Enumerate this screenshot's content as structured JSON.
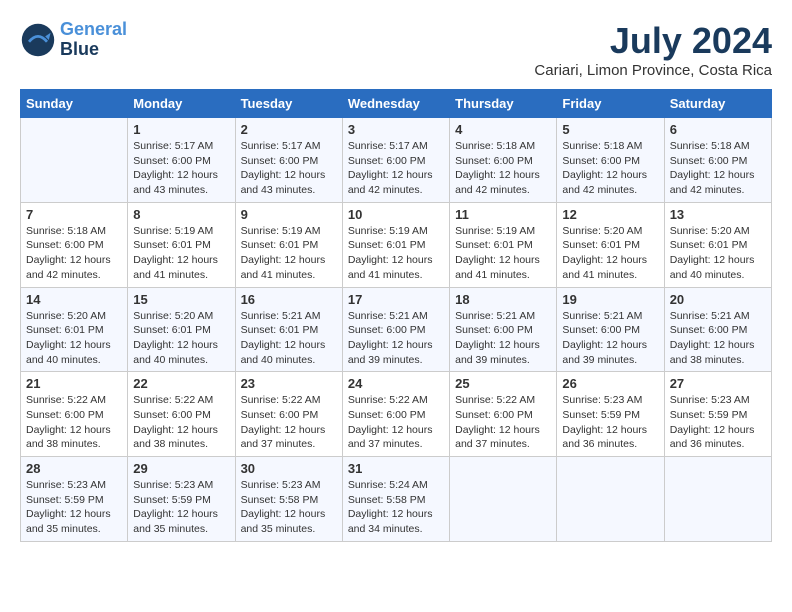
{
  "logo": {
    "line1": "General",
    "line2": "Blue"
  },
  "title": "July 2024",
  "subtitle": "Cariari, Limon Province, Costa Rica",
  "headers": [
    "Sunday",
    "Monday",
    "Tuesday",
    "Wednesday",
    "Thursday",
    "Friday",
    "Saturday"
  ],
  "weeks": [
    [
      {
        "day": "",
        "info": ""
      },
      {
        "day": "1",
        "info": "Sunrise: 5:17 AM\nSunset: 6:00 PM\nDaylight: 12 hours\nand 43 minutes."
      },
      {
        "day": "2",
        "info": "Sunrise: 5:17 AM\nSunset: 6:00 PM\nDaylight: 12 hours\nand 43 minutes."
      },
      {
        "day": "3",
        "info": "Sunrise: 5:17 AM\nSunset: 6:00 PM\nDaylight: 12 hours\nand 42 minutes."
      },
      {
        "day": "4",
        "info": "Sunrise: 5:18 AM\nSunset: 6:00 PM\nDaylight: 12 hours\nand 42 minutes."
      },
      {
        "day": "5",
        "info": "Sunrise: 5:18 AM\nSunset: 6:00 PM\nDaylight: 12 hours\nand 42 minutes."
      },
      {
        "day": "6",
        "info": "Sunrise: 5:18 AM\nSunset: 6:00 PM\nDaylight: 12 hours\nand 42 minutes."
      }
    ],
    [
      {
        "day": "7",
        "info": "Sunrise: 5:18 AM\nSunset: 6:00 PM\nDaylight: 12 hours\nand 42 minutes."
      },
      {
        "day": "8",
        "info": "Sunrise: 5:19 AM\nSunset: 6:01 PM\nDaylight: 12 hours\nand 41 minutes."
      },
      {
        "day": "9",
        "info": "Sunrise: 5:19 AM\nSunset: 6:01 PM\nDaylight: 12 hours\nand 41 minutes."
      },
      {
        "day": "10",
        "info": "Sunrise: 5:19 AM\nSunset: 6:01 PM\nDaylight: 12 hours\nand 41 minutes."
      },
      {
        "day": "11",
        "info": "Sunrise: 5:19 AM\nSunset: 6:01 PM\nDaylight: 12 hours\nand 41 minutes."
      },
      {
        "day": "12",
        "info": "Sunrise: 5:20 AM\nSunset: 6:01 PM\nDaylight: 12 hours\nand 41 minutes."
      },
      {
        "day": "13",
        "info": "Sunrise: 5:20 AM\nSunset: 6:01 PM\nDaylight: 12 hours\nand 40 minutes."
      }
    ],
    [
      {
        "day": "14",
        "info": "Sunrise: 5:20 AM\nSunset: 6:01 PM\nDaylight: 12 hours\nand 40 minutes."
      },
      {
        "day": "15",
        "info": "Sunrise: 5:20 AM\nSunset: 6:01 PM\nDaylight: 12 hours\nand 40 minutes."
      },
      {
        "day": "16",
        "info": "Sunrise: 5:21 AM\nSunset: 6:01 PM\nDaylight: 12 hours\nand 40 minutes."
      },
      {
        "day": "17",
        "info": "Sunrise: 5:21 AM\nSunset: 6:00 PM\nDaylight: 12 hours\nand 39 minutes."
      },
      {
        "day": "18",
        "info": "Sunrise: 5:21 AM\nSunset: 6:00 PM\nDaylight: 12 hours\nand 39 minutes."
      },
      {
        "day": "19",
        "info": "Sunrise: 5:21 AM\nSunset: 6:00 PM\nDaylight: 12 hours\nand 39 minutes."
      },
      {
        "day": "20",
        "info": "Sunrise: 5:21 AM\nSunset: 6:00 PM\nDaylight: 12 hours\nand 38 minutes."
      }
    ],
    [
      {
        "day": "21",
        "info": "Sunrise: 5:22 AM\nSunset: 6:00 PM\nDaylight: 12 hours\nand 38 minutes."
      },
      {
        "day": "22",
        "info": "Sunrise: 5:22 AM\nSunset: 6:00 PM\nDaylight: 12 hours\nand 38 minutes."
      },
      {
        "day": "23",
        "info": "Sunrise: 5:22 AM\nSunset: 6:00 PM\nDaylight: 12 hours\nand 37 minutes."
      },
      {
        "day": "24",
        "info": "Sunrise: 5:22 AM\nSunset: 6:00 PM\nDaylight: 12 hours\nand 37 minutes."
      },
      {
        "day": "25",
        "info": "Sunrise: 5:22 AM\nSunset: 6:00 PM\nDaylight: 12 hours\nand 37 minutes."
      },
      {
        "day": "26",
        "info": "Sunrise: 5:23 AM\nSunset: 5:59 PM\nDaylight: 12 hours\nand 36 minutes."
      },
      {
        "day": "27",
        "info": "Sunrise: 5:23 AM\nSunset: 5:59 PM\nDaylight: 12 hours\nand 36 minutes."
      }
    ],
    [
      {
        "day": "28",
        "info": "Sunrise: 5:23 AM\nSunset: 5:59 PM\nDaylight: 12 hours\nand 35 minutes."
      },
      {
        "day": "29",
        "info": "Sunrise: 5:23 AM\nSunset: 5:59 PM\nDaylight: 12 hours\nand 35 minutes."
      },
      {
        "day": "30",
        "info": "Sunrise: 5:23 AM\nSunset: 5:58 PM\nDaylight: 12 hours\nand 35 minutes."
      },
      {
        "day": "31",
        "info": "Sunrise: 5:24 AM\nSunset: 5:58 PM\nDaylight: 12 hours\nand 34 minutes."
      },
      {
        "day": "",
        "info": ""
      },
      {
        "day": "",
        "info": ""
      },
      {
        "day": "",
        "info": ""
      }
    ]
  ]
}
